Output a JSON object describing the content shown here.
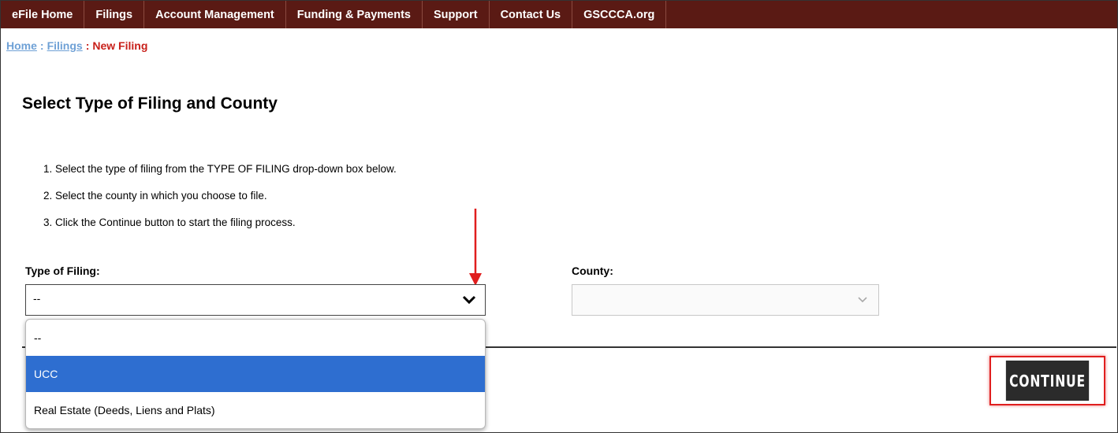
{
  "nav": {
    "items": [
      "eFile Home",
      "Filings",
      "Account Management",
      "Funding & Payments",
      "Support",
      "Contact Us",
      "GSCCCA.org"
    ]
  },
  "breadcrumb": {
    "home": "Home",
    "filings": "Filings",
    "current": "New Filing",
    "separator": ":"
  },
  "page": {
    "title": "Select Type of Filing and County",
    "steps": [
      "1. Select the type of filing from the TYPE OF FILING drop-down box below.",
      "2. Select the county in which you choose to file.",
      "3. Click the Continue button to start the filing process."
    ]
  },
  "form": {
    "type_label": "Type of Filing:",
    "type_value": "--",
    "county_label": "County:",
    "county_value": "",
    "type_options": [
      "--",
      "UCC",
      "Real Estate (Deeds, Liens and Plats)"
    ],
    "type_highlighted": "UCC"
  },
  "continue_label": "CONTINUE",
  "icons": {
    "type_chevron": "chevron-down-icon",
    "county_chevron": "chevron-down-icon",
    "annotation": "arrow-down-icon"
  },
  "colors": {
    "nav_bg": "#5a1a14",
    "highlight": "#2e6ed0",
    "annotation": "#e01e1e",
    "breadcrumb_link": "#6fa1d6",
    "breadcrumb_current": "#c8201a"
  }
}
